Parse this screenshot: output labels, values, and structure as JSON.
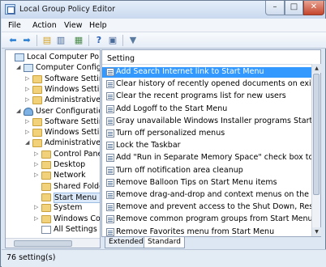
{
  "window": {
    "title": "Local Group Policy Editor"
  },
  "menu": [
    "File",
    "Action",
    "View",
    "Help"
  ],
  "tree": [
    {
      "label": "Local Computer Policy",
      "indent": 0,
      "icon": "pc",
      "expander": ""
    },
    {
      "label": "Computer Configura",
      "indent": 1,
      "icon": "pc",
      "expander": "▲"
    },
    {
      "label": "Software Settings",
      "indent": 2,
      "icon": "folder",
      "expander": "▷"
    },
    {
      "label": "Windows Setting",
      "indent": 2,
      "icon": "folder",
      "expander": "▷"
    },
    {
      "label": "Administrative Te",
      "indent": 2,
      "icon": "folder",
      "expander": "▷"
    },
    {
      "label": "User Configuration",
      "indent": 1,
      "icon": "user",
      "expander": "▲"
    },
    {
      "label": "Software Settings",
      "indent": 2,
      "icon": "folder",
      "expander": "▷"
    },
    {
      "label": "Windows Setting",
      "indent": 2,
      "icon": "folder",
      "expander": "▷"
    },
    {
      "label": "Administrative Te",
      "indent": 2,
      "icon": "folder",
      "expander": "▲"
    },
    {
      "label": "Control Panel",
      "indent": 3,
      "icon": "folder",
      "expander": "▷"
    },
    {
      "label": "Desktop",
      "indent": 3,
      "icon": "folder",
      "expander": "▷"
    },
    {
      "label": "Network",
      "indent": 3,
      "icon": "folder",
      "expander": "▷"
    },
    {
      "label": "Shared Folder",
      "indent": 3,
      "icon": "folder",
      "expander": ""
    },
    {
      "label": "Start Menu an",
      "indent": 3,
      "icon": "folder",
      "expander": "",
      "selected": true
    },
    {
      "label": "System",
      "indent": 3,
      "icon": "folder",
      "expander": "▷"
    },
    {
      "label": "Windows Cor",
      "indent": 3,
      "icon": "folder",
      "expander": "▷"
    },
    {
      "label": "All Settings",
      "indent": 3,
      "icon": "page",
      "expander": ""
    }
  ],
  "list": {
    "column_header": "Setting",
    "items": [
      "Add Search Internet link to Start Menu",
      "Clear history of recently opened documents on exit",
      "Clear the recent programs list for new users",
      "Add Logoff to the Start Menu",
      "Gray unavailable Windows Installer programs Start Menu sh",
      "Turn off personalized menus",
      "Lock the Taskbar",
      "Add \"Run in Separate Memory Space\" check box to Run dial",
      "Turn off notification area cleanup",
      "Remove Balloon Tips on Start Menu items",
      "Remove drag-and-drop and context menus on the Start Me",
      "Remove and prevent access to the Shut Down, Restart, Sleep",
      "Remove common program groups from Start Menu",
      "Remove Favorites menu from Start Menu"
    ],
    "selected_index": 0
  },
  "tabs": {
    "extended": "Extended",
    "standard": "Standard"
  },
  "status": {
    "text": "76 setting(s)"
  },
  "icons": [
    "back-icon",
    "forward-icon",
    "up-folder-icon",
    "show-hide-tree-icon",
    "export-list-icon",
    "help-icon",
    "properties-icon",
    "filter-icon"
  ]
}
